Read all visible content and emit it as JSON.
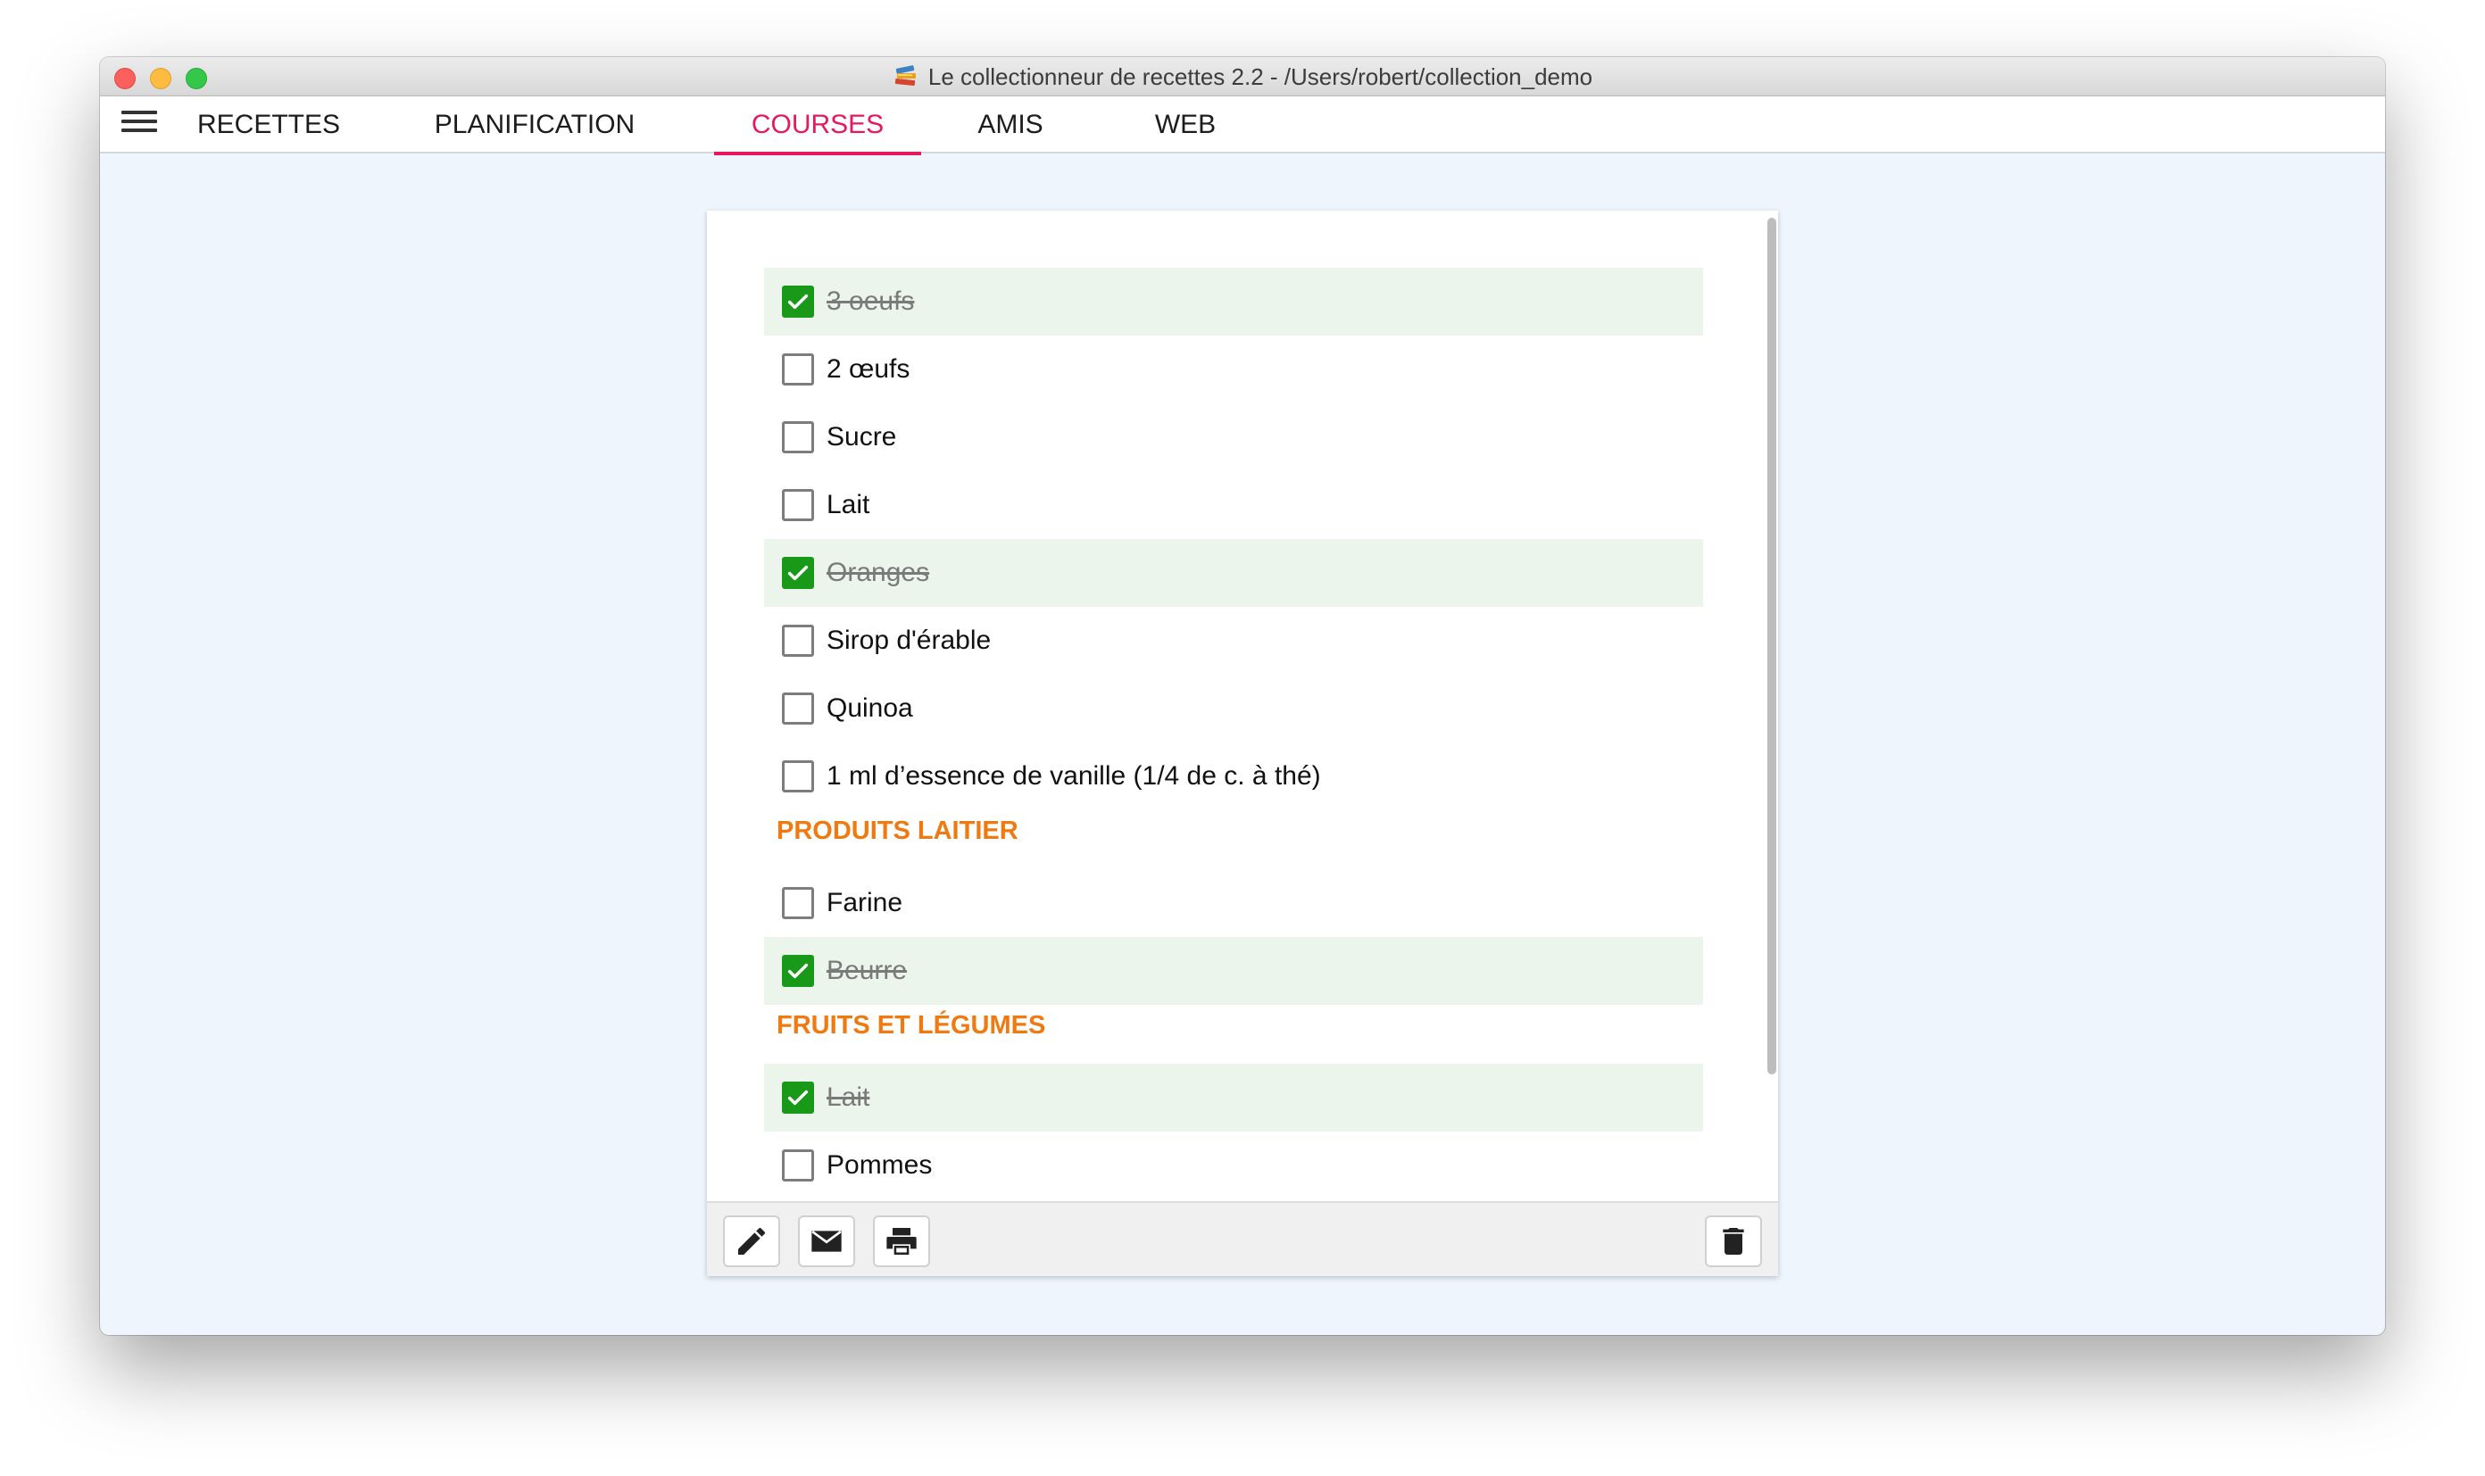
{
  "window": {
    "title": "Le collectionneur de recettes 2.2 - /Users/robert/collection_demo",
    "app_icon": "book-stack-icon"
  },
  "nav": {
    "menu_icon": "hamburger-menu-icon",
    "tabs": [
      {
        "label": "RECETTES",
        "active": false
      },
      {
        "label": "PLANIFICATION",
        "active": false
      },
      {
        "label": "COURSES",
        "active": true
      },
      {
        "label": "AMIS",
        "active": false
      },
      {
        "label": "WEB",
        "active": false
      }
    ],
    "accent_color": "#e8185d"
  },
  "shopping_list": {
    "items_ungrouped": [
      {
        "label": "3 oeufs",
        "checked": true
      },
      {
        "label": "2 œufs",
        "checked": false
      },
      {
        "label": "Sucre",
        "checked": false
      },
      {
        "label": "Lait",
        "checked": false
      },
      {
        "label": "Oranges",
        "checked": true
      },
      {
        "label": "Sirop d'érable",
        "checked": false
      },
      {
        "label": "Quinoa",
        "checked": false
      },
      {
        "label": "1 ml d’essence de vanille (1/4 de c. à thé)",
        "checked": false
      }
    ],
    "groups": [
      {
        "name": "PRODUITS LAITIER",
        "items": [
          {
            "label": "Farine",
            "checked": false
          },
          {
            "label": "Beurre",
            "checked": true
          }
        ]
      },
      {
        "name": "FRUITS ET LÉGUMES",
        "items": [
          {
            "label": "Lait",
            "checked": true
          },
          {
            "label": "Pommes",
            "checked": false
          }
        ]
      }
    ],
    "category_color": "#f07a12",
    "checked_color": "#189a18"
  },
  "toolbar": {
    "buttons": [
      {
        "icon": "pencil-icon",
        "action": "edit"
      },
      {
        "icon": "envelope-icon",
        "action": "email"
      },
      {
        "icon": "printer-icon",
        "action": "print"
      },
      {
        "icon": "trash-icon",
        "action": "delete"
      }
    ]
  }
}
